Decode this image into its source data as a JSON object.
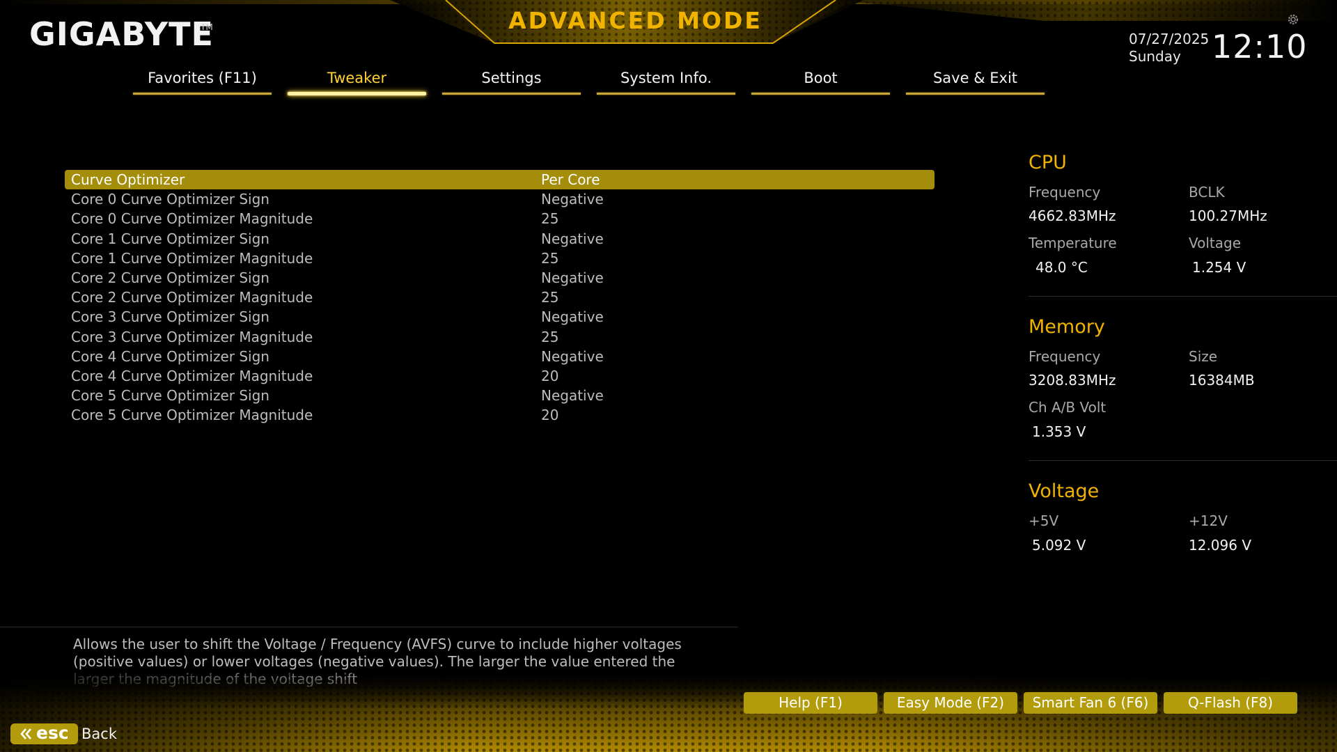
{
  "brand": {
    "name": "GIGABYTE",
    "trademark": "TM"
  },
  "mode_title": "ADVANCED MODE",
  "datetime": {
    "date": "07/27/2025",
    "day": "Sunday",
    "time": "12:10"
  },
  "icons": {
    "settings": "gear-icon",
    "esc": "double-chevron-left-icon"
  },
  "colors": {
    "accent": "#f0b400",
    "highlight_row": "#a38d0b",
    "button": "#b39c0c"
  },
  "tabs": [
    {
      "label": "Favorites (F11)",
      "active": false
    },
    {
      "label": "Tweaker",
      "active": true
    },
    {
      "label": "Settings",
      "active": false
    },
    {
      "label": "System Info.",
      "active": false
    },
    {
      "label": "Boot",
      "active": false
    },
    {
      "label": "Save & Exit",
      "active": false
    }
  ],
  "settings": [
    {
      "name": "Curve Optimizer",
      "value": "Per Core",
      "selected": true
    },
    {
      "name": "Core 0 Curve Optimizer Sign",
      "value": "Negative"
    },
    {
      "name": "Core 0 Curve Optimizer Magnitude",
      "value": "25"
    },
    {
      "name": "Core 1 Curve Optimizer Sign",
      "value": "Negative"
    },
    {
      "name": "Core 1 Curve Optimizer Magnitude",
      "value": "25"
    },
    {
      "name": "Core 2 Curve Optimizer Sign",
      "value": "Negative"
    },
    {
      "name": "Core 2 Curve Optimizer Magnitude",
      "value": "25"
    },
    {
      "name": "Core 3 Curve Optimizer Sign",
      "value": "Negative"
    },
    {
      "name": "Core 3 Curve Optimizer Magnitude",
      "value": "25"
    },
    {
      "name": "Core 4 Curve Optimizer Sign",
      "value": "Negative"
    },
    {
      "name": "Core 4 Curve Optimizer Magnitude",
      "value": "20"
    },
    {
      "name": "Core 5 Curve Optimizer Sign",
      "value": "Negative"
    },
    {
      "name": "Core 5 Curve Optimizer Magnitude",
      "value": "20"
    }
  ],
  "help_text": "Allows the user to shift the Voltage / Frequency (AVFS) curve to include higher voltages (positive values) or lower voltages (negative values). The larger the value entered the larger the magnitude of the voltage shift",
  "info_panel": {
    "cpu": {
      "title": "CPU",
      "frequency_label": "Frequency",
      "frequency_value": "4662.83MHz",
      "bclk_label": "BCLK",
      "bclk_value": "100.27MHz",
      "temperature_label": "Temperature",
      "temperature_value": "48.0 °C",
      "voltage_label": "Voltage",
      "voltage_value": "1.254 V"
    },
    "memory": {
      "title": "Memory",
      "frequency_label": "Frequency",
      "frequency_value": "3208.83MHz",
      "size_label": "Size",
      "size_value": "16384MB",
      "chab_volt_label": "Ch A/B Volt",
      "chab_volt_value": "1.353 V"
    },
    "voltage": {
      "title": "Voltage",
      "v5_label": "+5V",
      "v5_value": "5.092 V",
      "v12_label": "+12V",
      "v12_value": "12.096 V"
    }
  },
  "footer": {
    "buttons": [
      "Help (F1)",
      "Easy Mode (F2)",
      "Smart Fan 6 (F6)",
      "Q-Flash (F8)"
    ],
    "esc_label": "esc",
    "back_label": "Back"
  }
}
